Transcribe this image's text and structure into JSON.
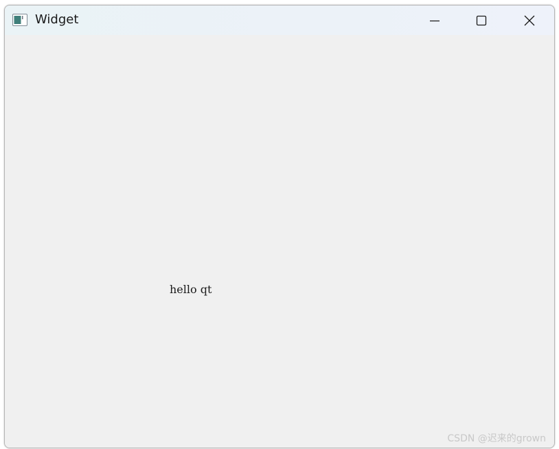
{
  "window": {
    "title": "Widget",
    "icon": "app-window-icon",
    "controls": {
      "minimize_icon": "minimize-icon",
      "maximize_icon": "maximize-icon",
      "close_icon": "close-icon"
    }
  },
  "content": {
    "label_text": "hello qt"
  },
  "watermark": {
    "text": "CSDN @迟来的grown"
  },
  "colors": {
    "titlebar": "#ecf2f8",
    "client_background": "#f0f0f0",
    "text": "#1a1a1a"
  }
}
